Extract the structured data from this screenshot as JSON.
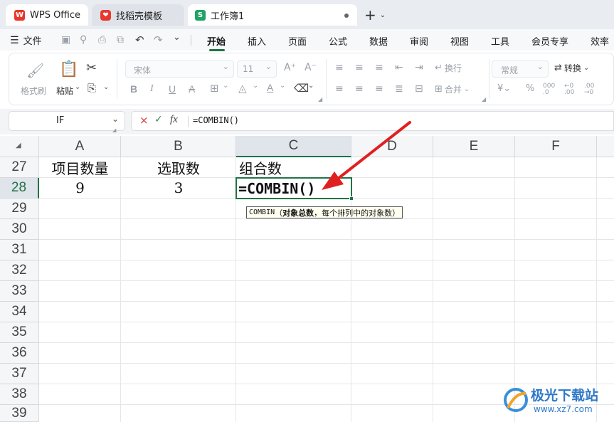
{
  "tabs": {
    "wps_label": "WPS Office",
    "template_label": "找稻壳模板",
    "workbook_label": "工作簿1",
    "workbook_icon_letter": "S",
    "add_label": "+"
  },
  "menu": {
    "file_label": "文件",
    "items": [
      "开始",
      "插入",
      "页面",
      "公式",
      "数据",
      "审阅",
      "视图",
      "工具",
      "会员专享",
      "效率"
    ],
    "active_index": 0
  },
  "ribbon": {
    "format_painter": "格式刷",
    "paste": "粘贴",
    "font_name": "宋体",
    "font_size": "11",
    "wrap": "换行",
    "merge": "合并",
    "number_format": "常规",
    "convert": "转换"
  },
  "formula_bar": {
    "name_box": "IF",
    "cancel_symbol": "×",
    "confirm_symbol": "✓",
    "fx_label": "fx",
    "formula": "=COMBIN()"
  },
  "sheet": {
    "columns": [
      "A",
      "B",
      "C",
      "D",
      "E",
      "F"
    ],
    "rows": [
      "27",
      "28",
      "29",
      "30",
      "31",
      "32",
      "33",
      "34",
      "35",
      "36",
      "37",
      "38",
      "39"
    ],
    "cells": {
      "a27": "项目数量",
      "b27": "选取数",
      "c27": "组合数",
      "a28": "9",
      "b28": "3",
      "c28": "=COMBIN()"
    },
    "tooltip": {
      "func": "COMBIN",
      "open": "（",
      "arg1": "对象总数",
      "sep": "，",
      "arg2": "每个排列中的对象数",
      "close": "）"
    }
  },
  "watermark": {
    "brand": "极光下载站",
    "url": "www.xz7.com"
  },
  "colors": {
    "accent_green": "#217346",
    "arrow_red": "#e02020",
    "wps_red": "#e8372c",
    "sheet_green": "#1fa464"
  }
}
